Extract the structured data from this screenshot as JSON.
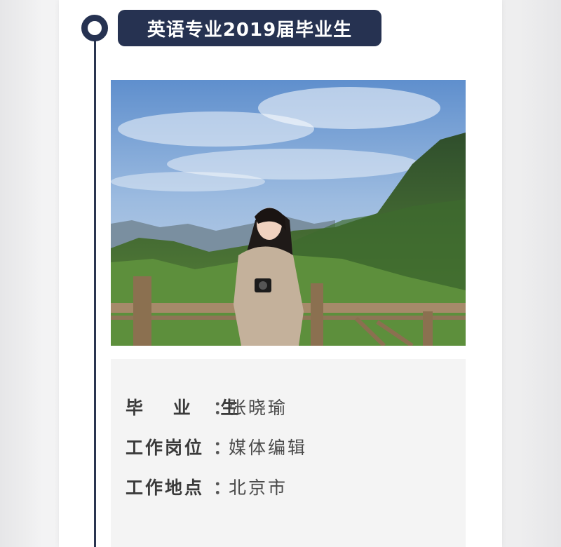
{
  "header": {
    "title": "英语专业2019届毕业生"
  },
  "photo": {
    "description_icon": "graduate-portrait-photo"
  },
  "info": {
    "rows": [
      {
        "label": "毕 业 生",
        "colon": "：",
        "value": "张晓瑜"
      },
      {
        "label": "工作岗位",
        "colon": "：",
        "value": "媒体编辑"
      },
      {
        "label": "工作地点",
        "colon": "：",
        "value": "北京市"
      }
    ]
  },
  "colors": {
    "accent": "#263251",
    "info_background": "#f4f4f4",
    "card": "#ffffff"
  }
}
